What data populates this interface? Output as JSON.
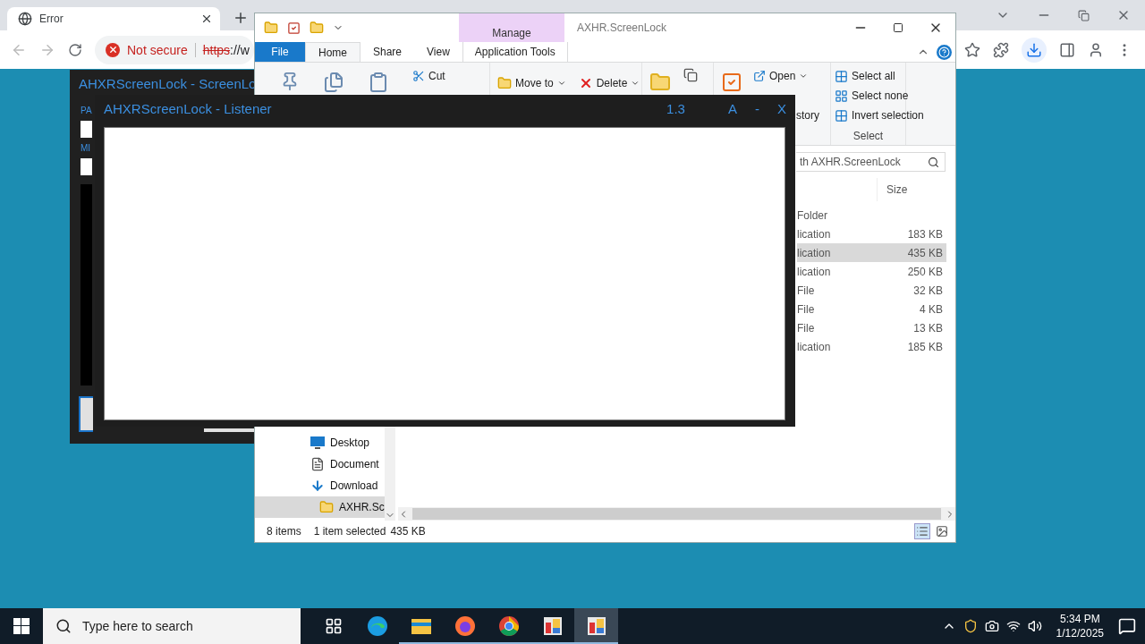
{
  "browser": {
    "tab": {
      "title": "Error",
      "selected": true
    },
    "security_label": "Not secure",
    "url": {
      "scheme": "https",
      "rest": "://w"
    }
  },
  "screenlock": {
    "title": "AHXRScreenLock - ScreenLo",
    "labels": [
      "PA",
      "MI"
    ]
  },
  "listener": {
    "title": "AHXRScreenLock - Listener",
    "version": "1.3",
    "controls": [
      "A",
      "-",
      "X"
    ]
  },
  "explorer": {
    "title": "AXHR.ScreenLock",
    "context_group": "Manage",
    "tabs": [
      {
        "label": "File",
        "kind": "file",
        "selected": false
      },
      {
        "label": "Home",
        "kind": "tab",
        "selected": true
      },
      {
        "label": "Share",
        "kind": "tab",
        "selected": false
      },
      {
        "label": "View",
        "kind": "tab",
        "selected": false
      },
      {
        "label": "Application Tools",
        "kind": "context",
        "selected": false
      }
    ],
    "ribbon": {
      "cut": "Cut",
      "move_to": "Move to",
      "delete": "Delete",
      "open": "Open",
      "history": "story",
      "select_items": [
        "Select all",
        "Select none",
        "Invert selection"
      ],
      "select_label": "Select"
    },
    "search": {
      "placeholder": "th AXHR.ScreenLock"
    },
    "size_column": "Size",
    "rows": [
      {
        "type": "Folder",
        "selected": false
      },
      {
        "type": "lication",
        "size": "183 KB",
        "selected": false
      },
      {
        "type": "lication",
        "size": "435 KB",
        "selected": true
      },
      {
        "type": "lication",
        "size": "250 KB",
        "selected": false
      },
      {
        "type": "File",
        "size": "32 KB",
        "selected": false
      },
      {
        "type": "File",
        "size": "4 KB",
        "selected": false
      },
      {
        "type": "File",
        "size": "13 KB",
        "selected": false
      },
      {
        "type": "lication",
        "size": "185 KB",
        "selected": false
      }
    ],
    "nav": [
      {
        "label": "Desktop",
        "kind": "desktop",
        "selected": false
      },
      {
        "label": "Document",
        "kind": "document",
        "selected": false
      },
      {
        "label": "Download",
        "kind": "download",
        "selected": false
      },
      {
        "label": "AXHR.Sc",
        "kind": "folder",
        "selected": true
      }
    ],
    "status": {
      "count": "8 items",
      "selection": "1 item selected",
      "size": "435 KB"
    }
  },
  "taskbar": {
    "search": {
      "placeholder": "Type here to search"
    },
    "apps": [
      {
        "kind": "taskview",
        "running": false,
        "selected": false
      },
      {
        "kind": "edge",
        "running": false,
        "selected": false
      },
      {
        "kind": "explorer",
        "running": true,
        "selected": false
      },
      {
        "kind": "firefox",
        "running": true,
        "selected": false
      },
      {
        "kind": "chrome",
        "running": true,
        "selected": false
      },
      {
        "kind": "app",
        "running": true,
        "selected": false
      },
      {
        "kind": "app",
        "running": true,
        "selected": true
      }
    ],
    "time": "5:34 PM",
    "date": "1/12/2025"
  }
}
